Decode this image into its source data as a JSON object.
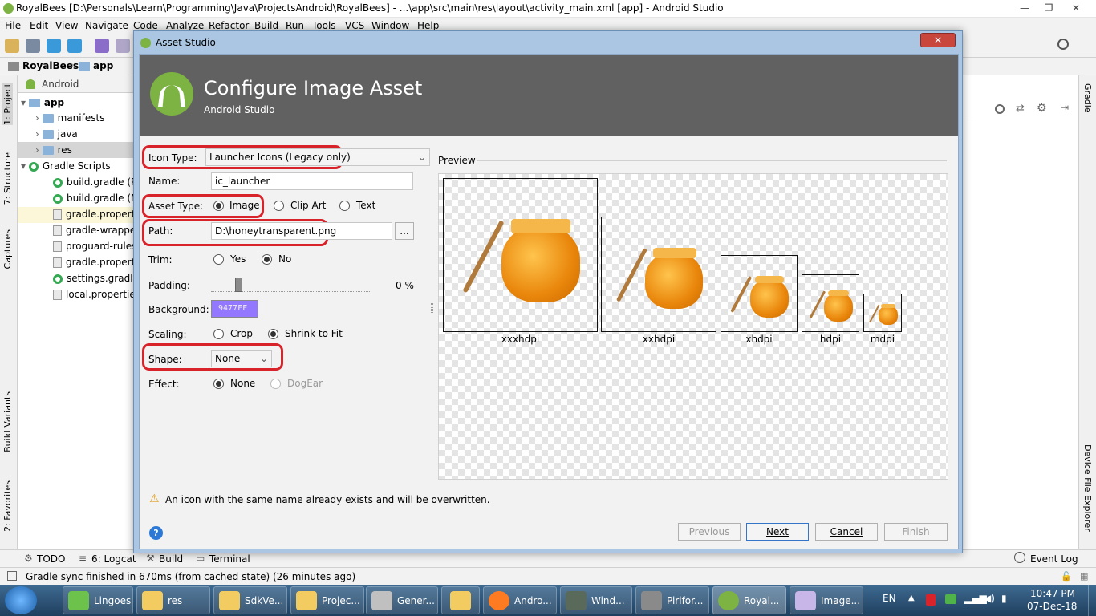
{
  "window": {
    "title": "RoyalBees [D:\\Personals\\Learn\\Programming\\Java\\ProjectsAndroid\\RoyalBees] - ...\\app\\src\\main\\res\\layout\\activity_main.xml [app] - Android Studio",
    "minimize": "—",
    "maximize": "❐",
    "close": "✕"
  },
  "menu": [
    "File",
    "Edit",
    "View",
    "Navigate",
    "Code",
    "Analyze",
    "Refactor",
    "Build",
    "Run",
    "Tools",
    "VCS",
    "Window",
    "Help"
  ],
  "breadcrumb": [
    "RoyalBees",
    "app"
  ],
  "project_panel": {
    "view_label": "Android",
    "items": [
      {
        "label": "app",
        "level": 0
      },
      {
        "label": "manifests",
        "level": 1
      },
      {
        "label": "java",
        "level": 1
      },
      {
        "label": "res",
        "level": 1
      },
      {
        "label": "Gradle Scripts",
        "level": 0
      },
      {
        "label": "build.gradle (Pr",
        "level": 1
      },
      {
        "label": "build.gradle (M",
        "level": 1
      },
      {
        "label": "gradle.propertie",
        "level": 1
      },
      {
        "label": "gradle-wrapper",
        "level": 1
      },
      {
        "label": "proguard-rules.",
        "level": 1
      },
      {
        "label": "gradle.propertie",
        "level": 1
      },
      {
        "label": "settings.gradle",
        "level": 1
      },
      {
        "label": "local.properties",
        "level": 1
      }
    ]
  },
  "left_tabs": [
    "1: Project",
    "7: Structure",
    "Captures",
    "Build Variants",
    "2: Favorites"
  ],
  "right_tabs": [
    "Gradle",
    "Device File Explorer"
  ],
  "dialog": {
    "window_title": "Asset Studio",
    "heading": "Configure Image Asset",
    "subheading": "Android Studio",
    "form": {
      "icon_type_label": "Icon Type:",
      "icon_type_value": "Launcher Icons (Legacy only)",
      "name_label": "Name:",
      "name_value": "ic_launcher",
      "asset_type_label": "Asset Type:",
      "asset_type_options": [
        "Image",
        "Clip Art",
        "Text"
      ],
      "path_label": "Path:",
      "path_value": "D:\\honeytransparent.png",
      "path_browse": "...",
      "trim_label": "Trim:",
      "trim_options": [
        "Yes",
        "No"
      ],
      "padding_label": "Padding:",
      "padding_value": "0 %",
      "padding_level": 0.0,
      "background_label": "Background:",
      "background_value": "9477FF",
      "background_color": "#9477ff",
      "scaling_label": "Scaling:",
      "scaling_options": [
        "Crop",
        "Shrink to Fit"
      ],
      "shape_label": "Shape:",
      "shape_value": "None",
      "effect_label": "Effect:",
      "effect_options": [
        "None",
        "DogEar"
      ]
    },
    "preview": {
      "label": "Preview",
      "densities": [
        "xxxhdpi",
        "xxhdpi",
        "xhdpi",
        "hdpi",
        "mdpi"
      ]
    },
    "warning": "An icon with the same name already exists and will be overwritten.",
    "help": "?",
    "buttons": {
      "previous": "Previous",
      "next": "Next",
      "cancel": "Cancel",
      "finish": "Finish"
    }
  },
  "bottom_tools": {
    "todo": "TODO",
    "logcat": "6: Logcat",
    "build": "Build",
    "terminal": "Terminal",
    "event_log": "Event Log"
  },
  "status": "Gradle sync finished in 670ms (from cached state) (26 minutes ago)",
  "taskbar": {
    "items": [
      "Lingoes",
      "res",
      "SdkVe...",
      "Projec...",
      "Gener...",
      "",
      "Andro...",
      "Wind...",
      "Pirifor...",
      "Royal...",
      "Image..."
    ],
    "lang": "EN",
    "time": "10:47 PM",
    "date": "07-Dec-18"
  }
}
